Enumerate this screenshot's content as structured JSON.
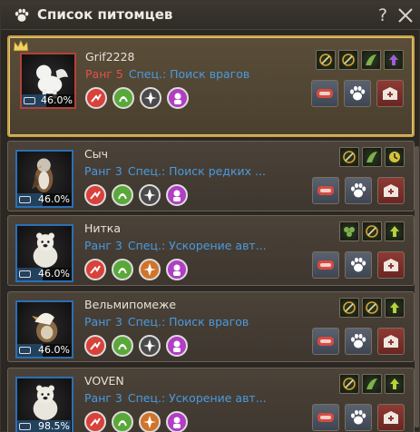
{
  "window": {
    "title": "Список питомцев",
    "help": "?"
  },
  "pets": [
    {
      "name": "Grif2228",
      "rank": "Ранг 5",
      "spec": "Спец.: Поиск врагов",
      "feed": "46.0%",
      "feed_level": 0.46,
      "selected": true,
      "rank_color": "#e2524a",
      "skills": [
        "#d9413b",
        "#5aa83a",
        "#4a4a4a",
        "#b13ec4"
      ],
      "traits": [
        "target",
        "target",
        "wing",
        "purple-arrow"
      ]
    },
    {
      "name": "Сыч",
      "rank": "Ранг 3",
      "spec": "Спец.: Поиск редких ...",
      "feed": "46.0%",
      "feed_level": 0.46,
      "selected": false,
      "rank_color": "#4a9ae0",
      "skills": [
        "#d9413b",
        "#5aa83a",
        "#4a4a4a",
        "#b13ec4"
      ],
      "traits": [
        "target",
        "wing",
        "clock"
      ]
    },
    {
      "name": "Нитка",
      "rank": "Ранг 3",
      "spec": "Спец.: Ускорение авт...",
      "feed": "46.0%",
      "feed_level": 0.46,
      "selected": false,
      "rank_color": "#4a9ae0",
      "skills": [
        "#d9413b",
        "#5aa83a",
        "#d0742a",
        "#b13ec4"
      ],
      "traits": [
        "clover",
        "target",
        "arrow"
      ]
    },
    {
      "name": "Вельмипомеже",
      "rank": "Ранг 3",
      "spec": "Спец.: Поиск врагов",
      "feed": "46.0%",
      "feed_level": 0.46,
      "selected": false,
      "rank_color": "#4a9ae0",
      "skills": [
        "#d9413b",
        "#5aa83a",
        "#4a4a4a",
        "#b13ec4"
      ],
      "traits": [
        "target",
        "target",
        "arrow"
      ]
    },
    {
      "name": "VOVEN",
      "rank": "Ранг 3",
      "spec": "Спец.: Ускорение авт...",
      "feed": "98.5%",
      "feed_level": 0.985,
      "selected": false,
      "rank_color": "#4a9ae0",
      "skills": [
        "#d9413b",
        "#5aa83a",
        "#d0742a",
        "#b13ec4"
      ],
      "traits": [
        "target",
        "wing",
        "arrow"
      ]
    }
  ],
  "icons": {
    "title": "paw-icon",
    "close": "close-icon",
    "feed": "bowl-icon",
    "command": "paw-icon",
    "release": "release-icon"
  }
}
